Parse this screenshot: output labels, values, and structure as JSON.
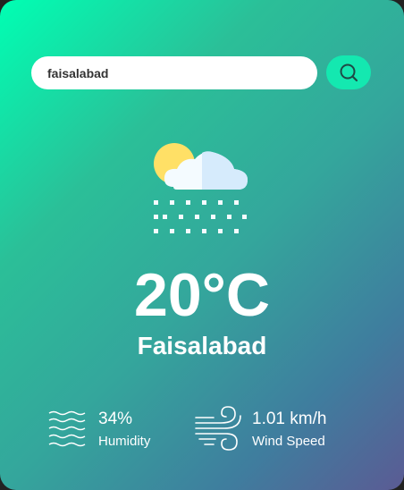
{
  "search": {
    "value": "faisalabad",
    "button_icon": "search-icon"
  },
  "weather": {
    "icon": "cloud-sun-snow-icon",
    "temperature": "20°C",
    "city": "Faisalabad"
  },
  "details": {
    "humidity": {
      "icon": "humidity-waves-icon",
      "value": "34%",
      "label": "Humidity"
    },
    "wind": {
      "icon": "wind-icon",
      "value": "1.01 km/h",
      "label": "Wind Speed"
    }
  },
  "colors": {
    "gradient_start": "#00ffb3",
    "gradient_end": "#5b5b94",
    "button": "#14e8b0",
    "text": "#ffffff"
  }
}
